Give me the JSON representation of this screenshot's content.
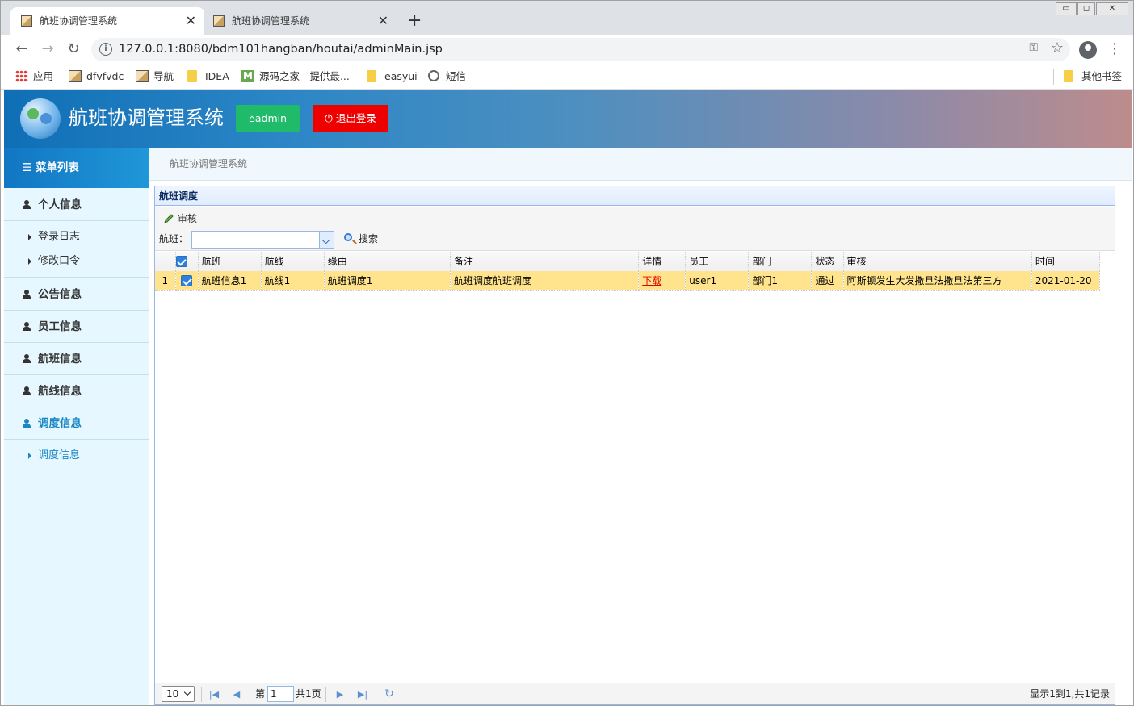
{
  "browser": {
    "tabs": [
      {
        "title": "航班协调管理系统",
        "active": true
      },
      {
        "title": "航班协调管理系统",
        "active": false
      }
    ],
    "new_tab_icon": "+",
    "url": "127.0.0.1:8080/bdm101hangban/houtai/adminMain.jsp",
    "bookmarks": [
      {
        "label": "应用",
        "icon": "apps-icon"
      },
      {
        "label": "dfvfvdc",
        "icon": "image-icon"
      },
      {
        "label": "导航",
        "icon": "image-icon"
      },
      {
        "label": "IDEA",
        "icon": "folder-icon"
      },
      {
        "label": "源码之家 - 提供最...",
        "icon": "m-icon"
      },
      {
        "label": "easyui",
        "icon": "folder-icon"
      },
      {
        "label": "短信",
        "icon": "globe-icon"
      }
    ],
    "other_bookmarks": "其他书签"
  },
  "header": {
    "system_name": "航班协调管理系统",
    "admin_button": "admin",
    "logout_button": "退出登录",
    "admin_color": "#1fba6a",
    "logout_color": "#ee0000"
  },
  "sidebar": {
    "title": "菜单列表",
    "groups": [
      {
        "label": "个人信息",
        "subitems": [
          "登录日志",
          "修改口令"
        ]
      },
      {
        "label": "公告信息"
      },
      {
        "label": "员工信息"
      },
      {
        "label": "航班信息"
      },
      {
        "label": "航线信息"
      },
      {
        "label": "调度信息",
        "active": true,
        "subitems": [
          "调度信息"
        ]
      }
    ]
  },
  "breadcrumb": "航班协调管理系统",
  "panel": {
    "title": "航班调度",
    "audit_button": "审核",
    "filter_label": "航班：",
    "filter_value": "",
    "search_button": "搜索"
  },
  "grid": {
    "columns": [
      "航班",
      "航线",
      "缘由",
      "备注",
      "详情",
      "员工",
      "部门",
      "状态",
      "审核",
      "时间"
    ],
    "rows": [
      {
        "row_number": "1",
        "checked": true,
        "cells": [
          "航班信息1",
          "航线1",
          "航班调度1",
          "航班调度航班调度",
          "下载",
          "user1",
          "部门1",
          "通过",
          "阿斯顿发生大发撒旦法撒旦法第三方",
          "2021-01-20"
        ]
      }
    ]
  },
  "pager": {
    "page_size": "10",
    "page_prefix": "第",
    "page_number": "1",
    "page_total": "共1页",
    "info": "显示1到1,共1记录"
  }
}
